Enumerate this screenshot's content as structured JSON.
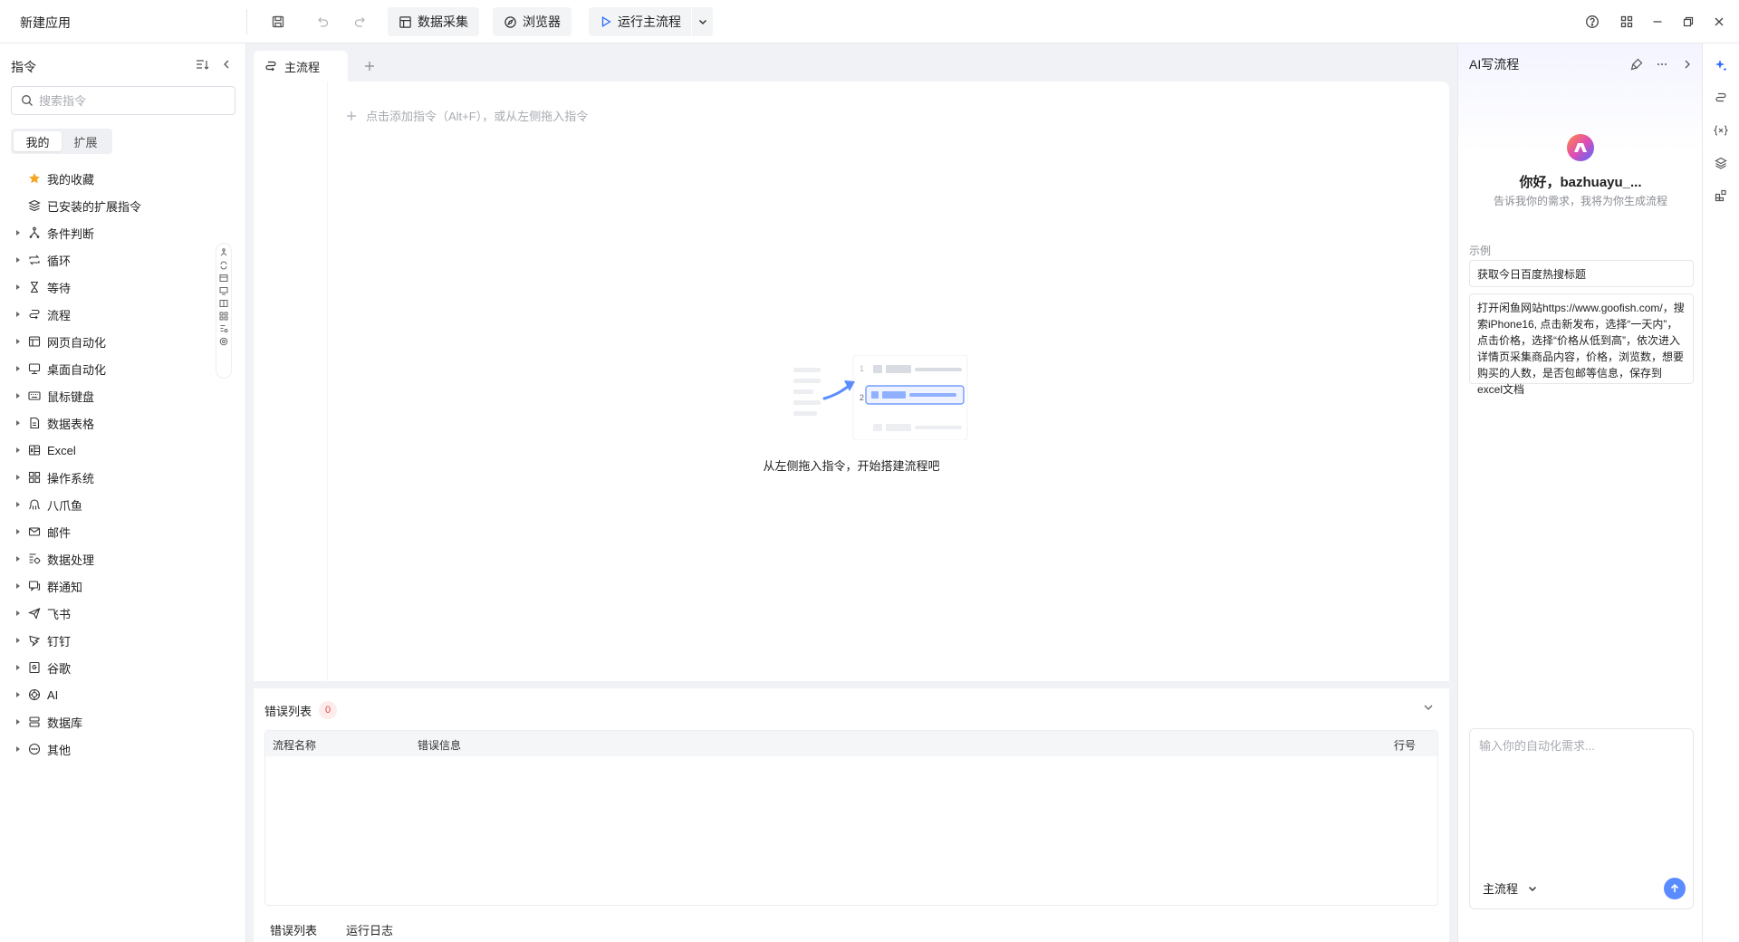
{
  "app": {
    "title": "新建应用"
  },
  "toolbar": {
    "data_collect_label": "数据采集",
    "browser_label": "浏览器",
    "run_label": "运行主流程",
    "icons": [
      "save-icon",
      "undo-icon",
      "redo-icon",
      "help-icon",
      "apps-grid-icon",
      "minimize-icon",
      "restore-icon",
      "close-icon"
    ]
  },
  "left": {
    "title": "指令",
    "search_placeholder": "搜索指令",
    "seg": {
      "mine": "我的",
      "ext": "扩展"
    },
    "items": [
      {
        "label": "我的收藏",
        "icon": "star-icon",
        "expandable": false
      },
      {
        "label": "已安装的扩展指令",
        "icon": "extension-stack-icon",
        "expandable": false
      },
      {
        "label": "条件判断",
        "icon": "branch-icon",
        "expandable": true
      },
      {
        "label": "循环",
        "icon": "loop-icon",
        "expandable": true
      },
      {
        "label": "等待",
        "icon": "hourglass-icon",
        "expandable": true
      },
      {
        "label": "流程",
        "icon": "flow-icon",
        "expandable": true
      },
      {
        "label": "网页自动化",
        "icon": "web-page-icon",
        "expandable": true
      },
      {
        "label": "桌面自动化",
        "icon": "desktop-icon",
        "expandable": true
      },
      {
        "label": "鼠标键盘",
        "icon": "keyboard-icon",
        "expandable": true
      },
      {
        "label": "数据表格",
        "icon": "data-sheet-icon",
        "expandable": true
      },
      {
        "label": "Excel",
        "icon": "excel-icon",
        "expandable": true
      },
      {
        "label": "操作系统",
        "icon": "os-grid-icon",
        "expandable": true
      },
      {
        "label": "八爪鱼",
        "icon": "octopus-icon",
        "expandable": true
      },
      {
        "label": "邮件",
        "icon": "mail-icon",
        "expandable": true
      },
      {
        "label": "数据处理",
        "icon": "data-process-icon",
        "expandable": true
      },
      {
        "label": "群通知",
        "icon": "group-notify-icon",
        "expandable": true
      },
      {
        "label": "飞书",
        "icon": "feishu-icon",
        "expandable": true
      },
      {
        "label": "钉钉",
        "icon": "dingtalk-icon",
        "expandable": true
      },
      {
        "label": "谷歌",
        "icon": "google-icon",
        "expandable": true
      },
      {
        "label": "AI",
        "icon": "ai-icon",
        "expandable": true
      },
      {
        "label": "数据库",
        "icon": "database-icon",
        "expandable": true
      },
      {
        "label": "其他",
        "icon": "more-circle-icon",
        "expandable": true
      }
    ]
  },
  "center": {
    "tab_label": "主流程",
    "add_hint": "点击添加指令（Alt+F），或从左侧拖入指令",
    "empty_text": "从左侧拖入指令，开始搭建流程吧",
    "illus_step1": "1",
    "illus_step2": "2"
  },
  "errors": {
    "title": "错误列表",
    "count": "0",
    "columns": {
      "flow_name": "流程名称",
      "error_info": "错误信息",
      "line_no": "行号"
    },
    "tabs": {
      "error_list": "错误列表",
      "run_log": "运行日志"
    }
  },
  "ai": {
    "title": "AI写流程",
    "greeting": "你好，bazhuayu_...",
    "subtitle": "告诉我你的需求，我将为你生成流程",
    "example_label": "示例",
    "examples": [
      "获取今日百度热搜标题",
      "打开闲鱼网站https://www.goofish.com/，搜索iPhone16, 点击新发布，选择“一天内”，点击价格，选择“价格从低到高”，依次进入详情页采集商品内容，价格，浏览数，想要购买的人数，是否包邮等信息，保存到excel文档"
    ],
    "input_placeholder": "输入你的自动化需求...",
    "flow_select": "主流程"
  },
  "colors": {
    "accent": "#2f6bff",
    "badge_bg": "#fdecec",
    "badge_fg": "#e5484d"
  }
}
